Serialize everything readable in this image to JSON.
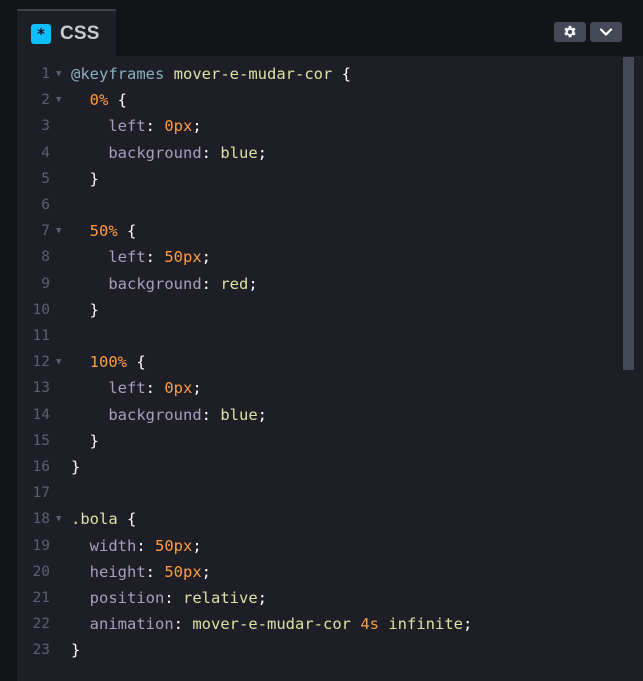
{
  "tab": {
    "icon_glyph": "*",
    "icon_name": "css-icon",
    "label": "CSS",
    "accent": "#0ebeff"
  },
  "buttons": {
    "settings_icon": "gear-icon",
    "collapse_icon": "chevron-down-icon"
  },
  "colors": {
    "background": "#1e1f26",
    "at_rule": "#88afbf",
    "name": "#dde1a3",
    "number": "#ff9b43",
    "property": "#a99dbf"
  },
  "lines": [
    {
      "n": "1",
      "fold": true,
      "indent": 0,
      "tokens": [
        [
          "at",
          "@keyframes"
        ],
        [
          "punc",
          " "
        ],
        [
          "name",
          "mover-e-mudar-cor"
        ],
        [
          "punc",
          " {"
        ]
      ]
    },
    {
      "n": "2",
      "fold": true,
      "indent": 1,
      "tokens": [
        [
          "pct",
          "0%"
        ],
        [
          "punc",
          " {"
        ]
      ]
    },
    {
      "n": "3",
      "fold": false,
      "indent": 2,
      "tokens": [
        [
          "prop",
          "left"
        ],
        [
          "punc",
          ": "
        ],
        [
          "num",
          "0px"
        ],
        [
          "punc",
          ";"
        ]
      ]
    },
    {
      "n": "4",
      "fold": false,
      "indent": 2,
      "tokens": [
        [
          "prop",
          "background"
        ],
        [
          "punc",
          ": "
        ],
        [
          "val",
          "blue"
        ],
        [
          "punc",
          ";"
        ]
      ]
    },
    {
      "n": "5",
      "fold": false,
      "indent": 1,
      "tokens": [
        [
          "punc",
          "}"
        ]
      ]
    },
    {
      "n": "6",
      "fold": false,
      "indent": 0,
      "tokens": []
    },
    {
      "n": "7",
      "fold": true,
      "indent": 1,
      "tokens": [
        [
          "pct",
          "50%"
        ],
        [
          "punc",
          " {"
        ]
      ]
    },
    {
      "n": "8",
      "fold": false,
      "indent": 2,
      "tokens": [
        [
          "prop",
          "left"
        ],
        [
          "punc",
          ": "
        ],
        [
          "num",
          "50px"
        ],
        [
          "punc",
          ";"
        ]
      ]
    },
    {
      "n": "9",
      "fold": false,
      "indent": 2,
      "tokens": [
        [
          "prop",
          "background"
        ],
        [
          "punc",
          ": "
        ],
        [
          "val",
          "red"
        ],
        [
          "punc",
          ";"
        ]
      ]
    },
    {
      "n": "10",
      "fold": false,
      "indent": 1,
      "tokens": [
        [
          "punc",
          "}"
        ]
      ]
    },
    {
      "n": "11",
      "fold": false,
      "indent": 0,
      "tokens": []
    },
    {
      "n": "12",
      "fold": true,
      "indent": 1,
      "tokens": [
        [
          "pct",
          "100%"
        ],
        [
          "punc",
          " {"
        ]
      ]
    },
    {
      "n": "13",
      "fold": false,
      "indent": 2,
      "tokens": [
        [
          "prop",
          "left"
        ],
        [
          "punc",
          ": "
        ],
        [
          "num",
          "0px"
        ],
        [
          "punc",
          ";"
        ]
      ]
    },
    {
      "n": "14",
      "fold": false,
      "indent": 2,
      "tokens": [
        [
          "prop",
          "background"
        ],
        [
          "punc",
          ": "
        ],
        [
          "val",
          "blue"
        ],
        [
          "punc",
          ";"
        ]
      ]
    },
    {
      "n": "15",
      "fold": false,
      "indent": 1,
      "tokens": [
        [
          "punc",
          "}"
        ]
      ]
    },
    {
      "n": "16",
      "fold": false,
      "indent": 0,
      "tokens": [
        [
          "punc",
          "}"
        ]
      ]
    },
    {
      "n": "17",
      "fold": false,
      "indent": 0,
      "tokens": []
    },
    {
      "n": "18",
      "fold": true,
      "indent": 0,
      "tokens": [
        [
          "sel",
          ".bola"
        ],
        [
          "punc",
          " {"
        ]
      ]
    },
    {
      "n": "19",
      "fold": false,
      "indent": 1,
      "tokens": [
        [
          "prop",
          "width"
        ],
        [
          "punc",
          ": "
        ],
        [
          "num",
          "50px"
        ],
        [
          "punc",
          ";"
        ]
      ]
    },
    {
      "n": "20",
      "fold": false,
      "indent": 1,
      "tokens": [
        [
          "prop",
          "height"
        ],
        [
          "punc",
          ": "
        ],
        [
          "num",
          "50px"
        ],
        [
          "punc",
          ";"
        ]
      ]
    },
    {
      "n": "21",
      "fold": false,
      "indent": 1,
      "tokens": [
        [
          "prop",
          "position"
        ],
        [
          "punc",
          ": "
        ],
        [
          "val",
          "relative"
        ],
        [
          "punc",
          ";"
        ]
      ]
    },
    {
      "n": "22",
      "fold": false,
      "indent": 1,
      "tokens": [
        [
          "prop",
          "animation"
        ],
        [
          "punc",
          ": "
        ],
        [
          "name",
          "mover-e-mudar-cor"
        ],
        [
          "punc",
          " "
        ],
        [
          "num",
          "4s"
        ],
        [
          "punc",
          " "
        ],
        [
          "val",
          "infinite"
        ],
        [
          "punc",
          ";"
        ]
      ]
    },
    {
      "n": "23",
      "fold": false,
      "indent": 0,
      "tokens": [
        [
          "punc",
          "}"
        ]
      ]
    }
  ]
}
